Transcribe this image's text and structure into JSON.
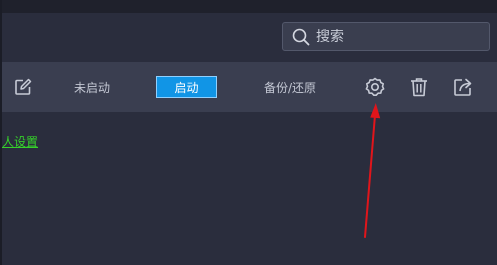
{
  "search": {
    "placeholder": "搜索",
    "value": ""
  },
  "toolbar": {
    "edit_icon": "edit-icon",
    "disabled_label": "未启动",
    "enable_label": "启动",
    "backup_label": "备份/还原",
    "settings_icon": "gear-icon",
    "delete_icon": "trash-icon",
    "share_icon": "share-icon"
  },
  "content": {
    "link_text": "人设置"
  },
  "annotation": {
    "arrow_color": "#e0151b"
  },
  "colors": {
    "background": "#2a2d3d",
    "toolbar": "#3a3e50",
    "accent": "#1195e6",
    "link": "#35d22a"
  }
}
